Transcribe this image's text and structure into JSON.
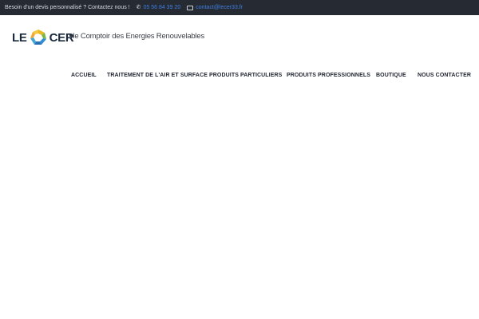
{
  "topbar": {
    "message": "Besoin d'un devis personnalisé ? Contactez nous !",
    "phone_icon": "phone-icon",
    "phone": "05 56 84 39 20",
    "email_icon": "mail-icon",
    "email": "contact@lecer33.fr"
  },
  "header": {
    "logo_left": "LE",
    "logo_right": "CER",
    "tagline": "le Comptoir des Energies Renouvelables"
  },
  "nav": {
    "items": [
      {
        "label": "ACCUEIL"
      },
      {
        "label": "TRAITEMENT DE L'AIR ET SURFACE"
      },
      {
        "label": "PRODUITS PARTICULIERS"
      },
      {
        "label": "PRODUITS PROFESSIONNELS"
      },
      {
        "label": "BOUTIQUE"
      },
      {
        "label": "NOUS CONTACTER"
      }
    ]
  },
  "colors": {
    "topbar_bg": "#262a33",
    "link": "#3e7fe0",
    "nav_text": "#1f2430"
  }
}
